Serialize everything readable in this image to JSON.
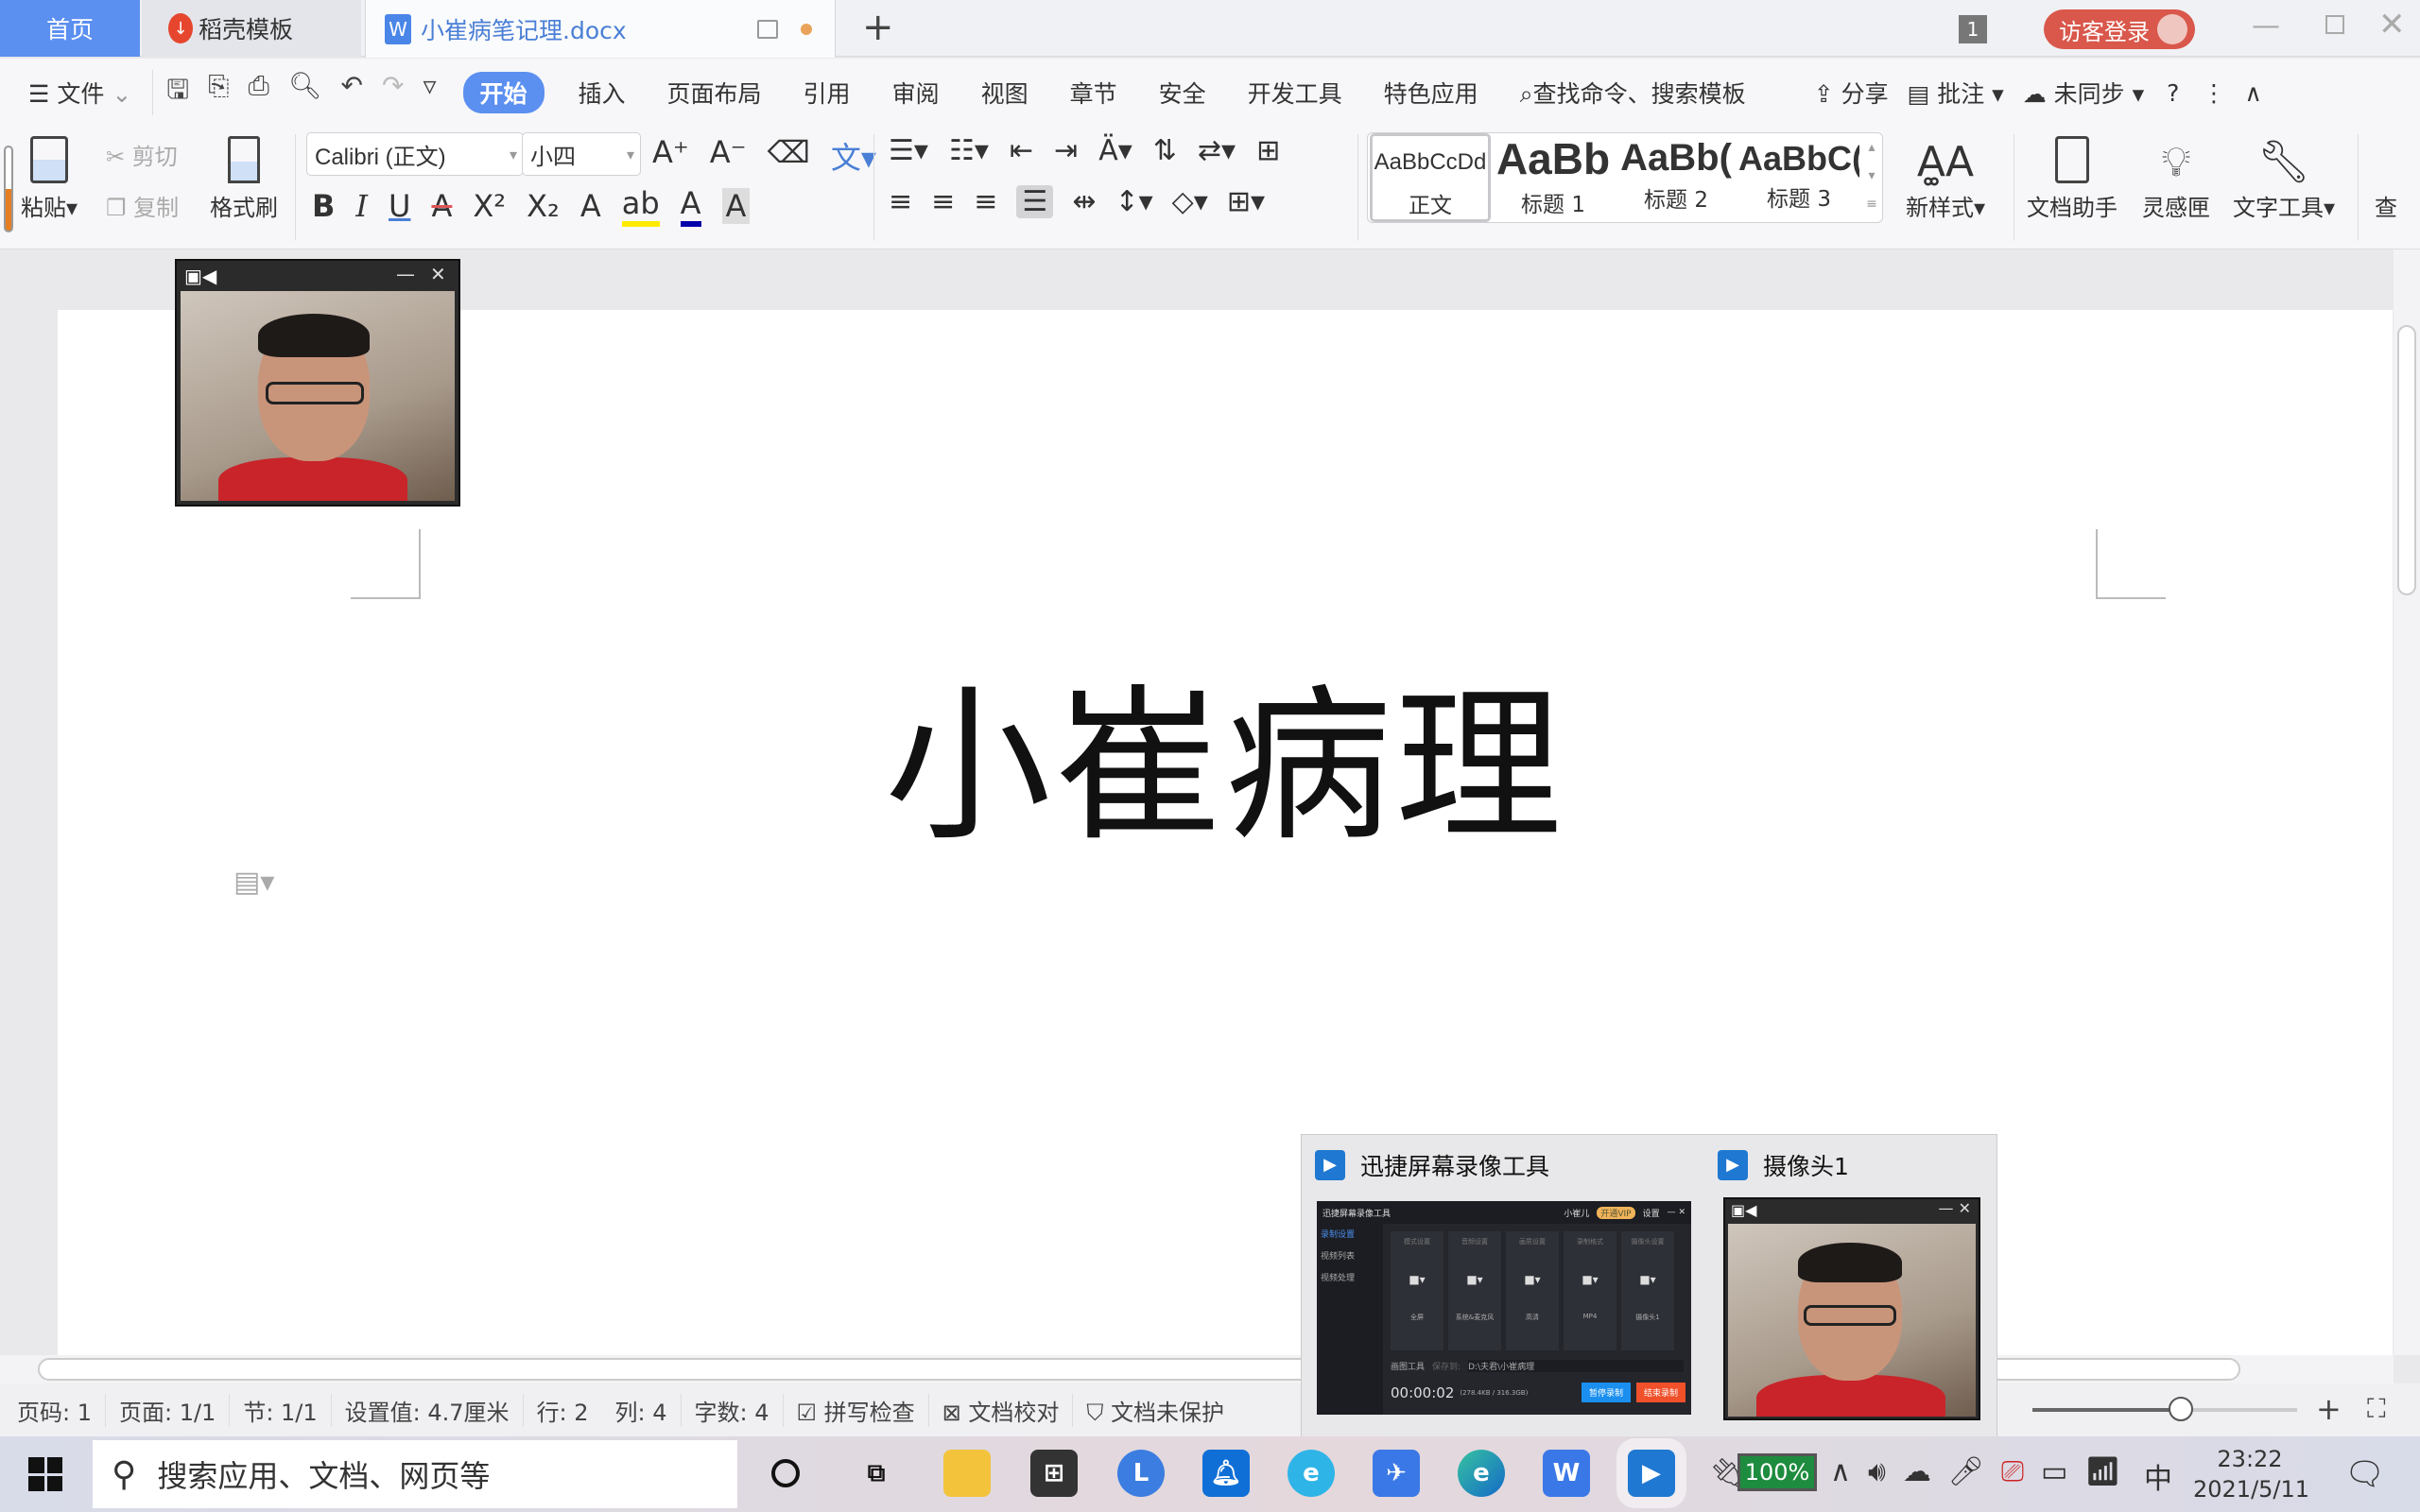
{
  "tabs": {
    "home": "首页",
    "daoke": "稻壳模板",
    "doc": "小崔病笔记理.docx",
    "new_tab": "+"
  },
  "titlebar": {
    "window_count": "1",
    "login": "访客登录"
  },
  "menu": {
    "file": "文件",
    "items": [
      "开始",
      "插入",
      "页面布局",
      "引用",
      "审阅",
      "视图",
      "章节",
      "安全",
      "开发工具",
      "特色应用"
    ],
    "active": "开始",
    "search": "查找命令、搜索模板",
    "share": "分享",
    "comment": "批注",
    "sync": "未同步",
    "help": "?"
  },
  "ribbon": {
    "paste": "粘贴",
    "cut": "剪切",
    "copy": "复制",
    "format_painter": "格式刷",
    "font_name": "Calibri (正文)",
    "font_size": "小四",
    "styles": [
      {
        "preview": "AaBbCcDd",
        "label": "正文"
      },
      {
        "preview": "AaBb",
        "label": "标题 1"
      },
      {
        "preview": "AaBb(",
        "label": "标题 2"
      },
      {
        "preview": "AaBbC(",
        "label": "标题 3"
      }
    ],
    "new_style": "新样式",
    "doc_assistant": "文档助手",
    "inspiration": "灵感匣",
    "text_tools": "文字工具",
    "find": "查"
  },
  "document": {
    "title": "小崔病理"
  },
  "status": {
    "page_code": "页码: 1",
    "pages": "页面: 1/1",
    "section": "节: 1/1",
    "setting": "设置值: 4.7厘米",
    "row": "行: 2",
    "col": "列: 4",
    "words": "字数: 4",
    "spell": "拼写检查",
    "proof": "文档校对",
    "protect": "文档未保护"
  },
  "preview": {
    "app1": "迅捷屏幕录像工具",
    "app2": "摄像头1",
    "inner": {
      "title": "迅捷屏幕录像工具",
      "user": "小崔儿",
      "vip": "开通VIP",
      "settings": "设置",
      "side": [
        "录制设置",
        "视频列表",
        "视频处理"
      ],
      "cards": [
        {
          "h": "模式设置",
          "v": "全屏"
        },
        {
          "h": "音频设置",
          "v": "系统&麦克风"
        },
        {
          "h": "画质设置",
          "v": "高清"
        },
        {
          "h": "录制格式",
          "v": "MP4"
        },
        {
          "h": "摄像头设置",
          "v": "摄像头1"
        }
      ],
      "draw_tool": "画图工具",
      "save_to": "保存到:",
      "path": "D:\\夫君\\小崔病理",
      "time": "00:00:02",
      "size": "(278.4KB / 316.3GB)",
      "pause": "暂停录制",
      "stop": "结束录制"
    }
  },
  "taskbar": {
    "search": "搜索应用、文档、网页等",
    "battery": "100%",
    "ime": "中",
    "time": "23:22",
    "date": "2021/5/11"
  },
  "colors": {
    "accent": "#5b8ff0",
    "login": "#d9574b",
    "stop": "#f0502a",
    "pause": "#1a8ff0"
  }
}
